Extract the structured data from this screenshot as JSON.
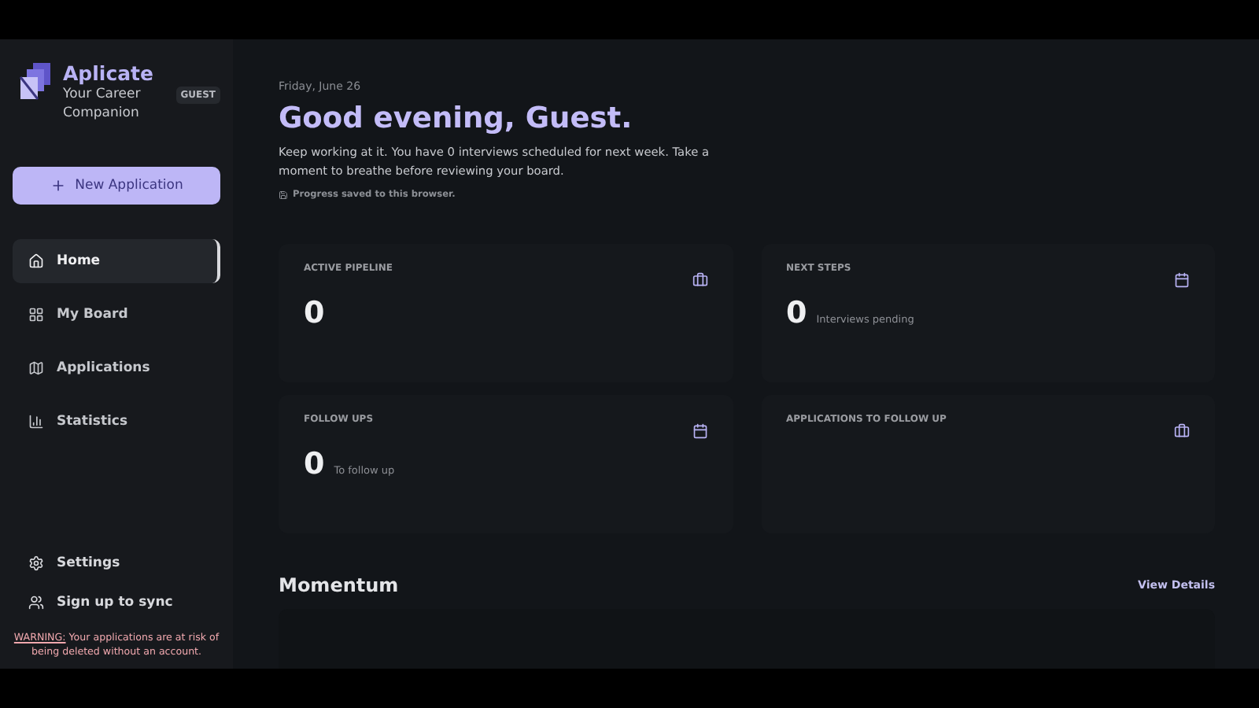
{
  "brand": {
    "name": "Aplicate",
    "tagline": "Your Career Companion",
    "badge": "GUEST"
  },
  "new_button": {
    "label": "New Application"
  },
  "nav": [
    {
      "label": "Home",
      "selected": true
    },
    {
      "label": "My Board",
      "selected": false
    },
    {
      "label": "Applications",
      "selected": false
    },
    {
      "label": "Statistics",
      "selected": false
    }
  ],
  "footer_links": [
    {
      "label": "Settings"
    },
    {
      "label": "Sign up to sync"
    }
  ],
  "warning": {
    "label": "WARNING:",
    "message": " Your applications are at risk of being deleted without an account."
  },
  "header": {
    "date": "Friday, June 26",
    "greeting": "Good evening, Guest.",
    "message": "Keep working at it. You have 0 interviews scheduled for next week. Take a moment to breathe before reviewing your board.",
    "saved_note": "Progress saved to this browser."
  },
  "stats": [
    {
      "title": "ACTIVE PIPELINE",
      "value": "0"
    },
    {
      "title": "NEXT STEPS",
      "value": "0",
      "caption": "Interviews pending"
    },
    {
      "title": "FOLLOW UPS",
      "value": "0",
      "caption": "To follow up"
    },
    {
      "title": "APPLICATIONS TO FOLLOW UP"
    }
  ],
  "momentum": {
    "title": "Momentum",
    "link": "View Details"
  }
}
